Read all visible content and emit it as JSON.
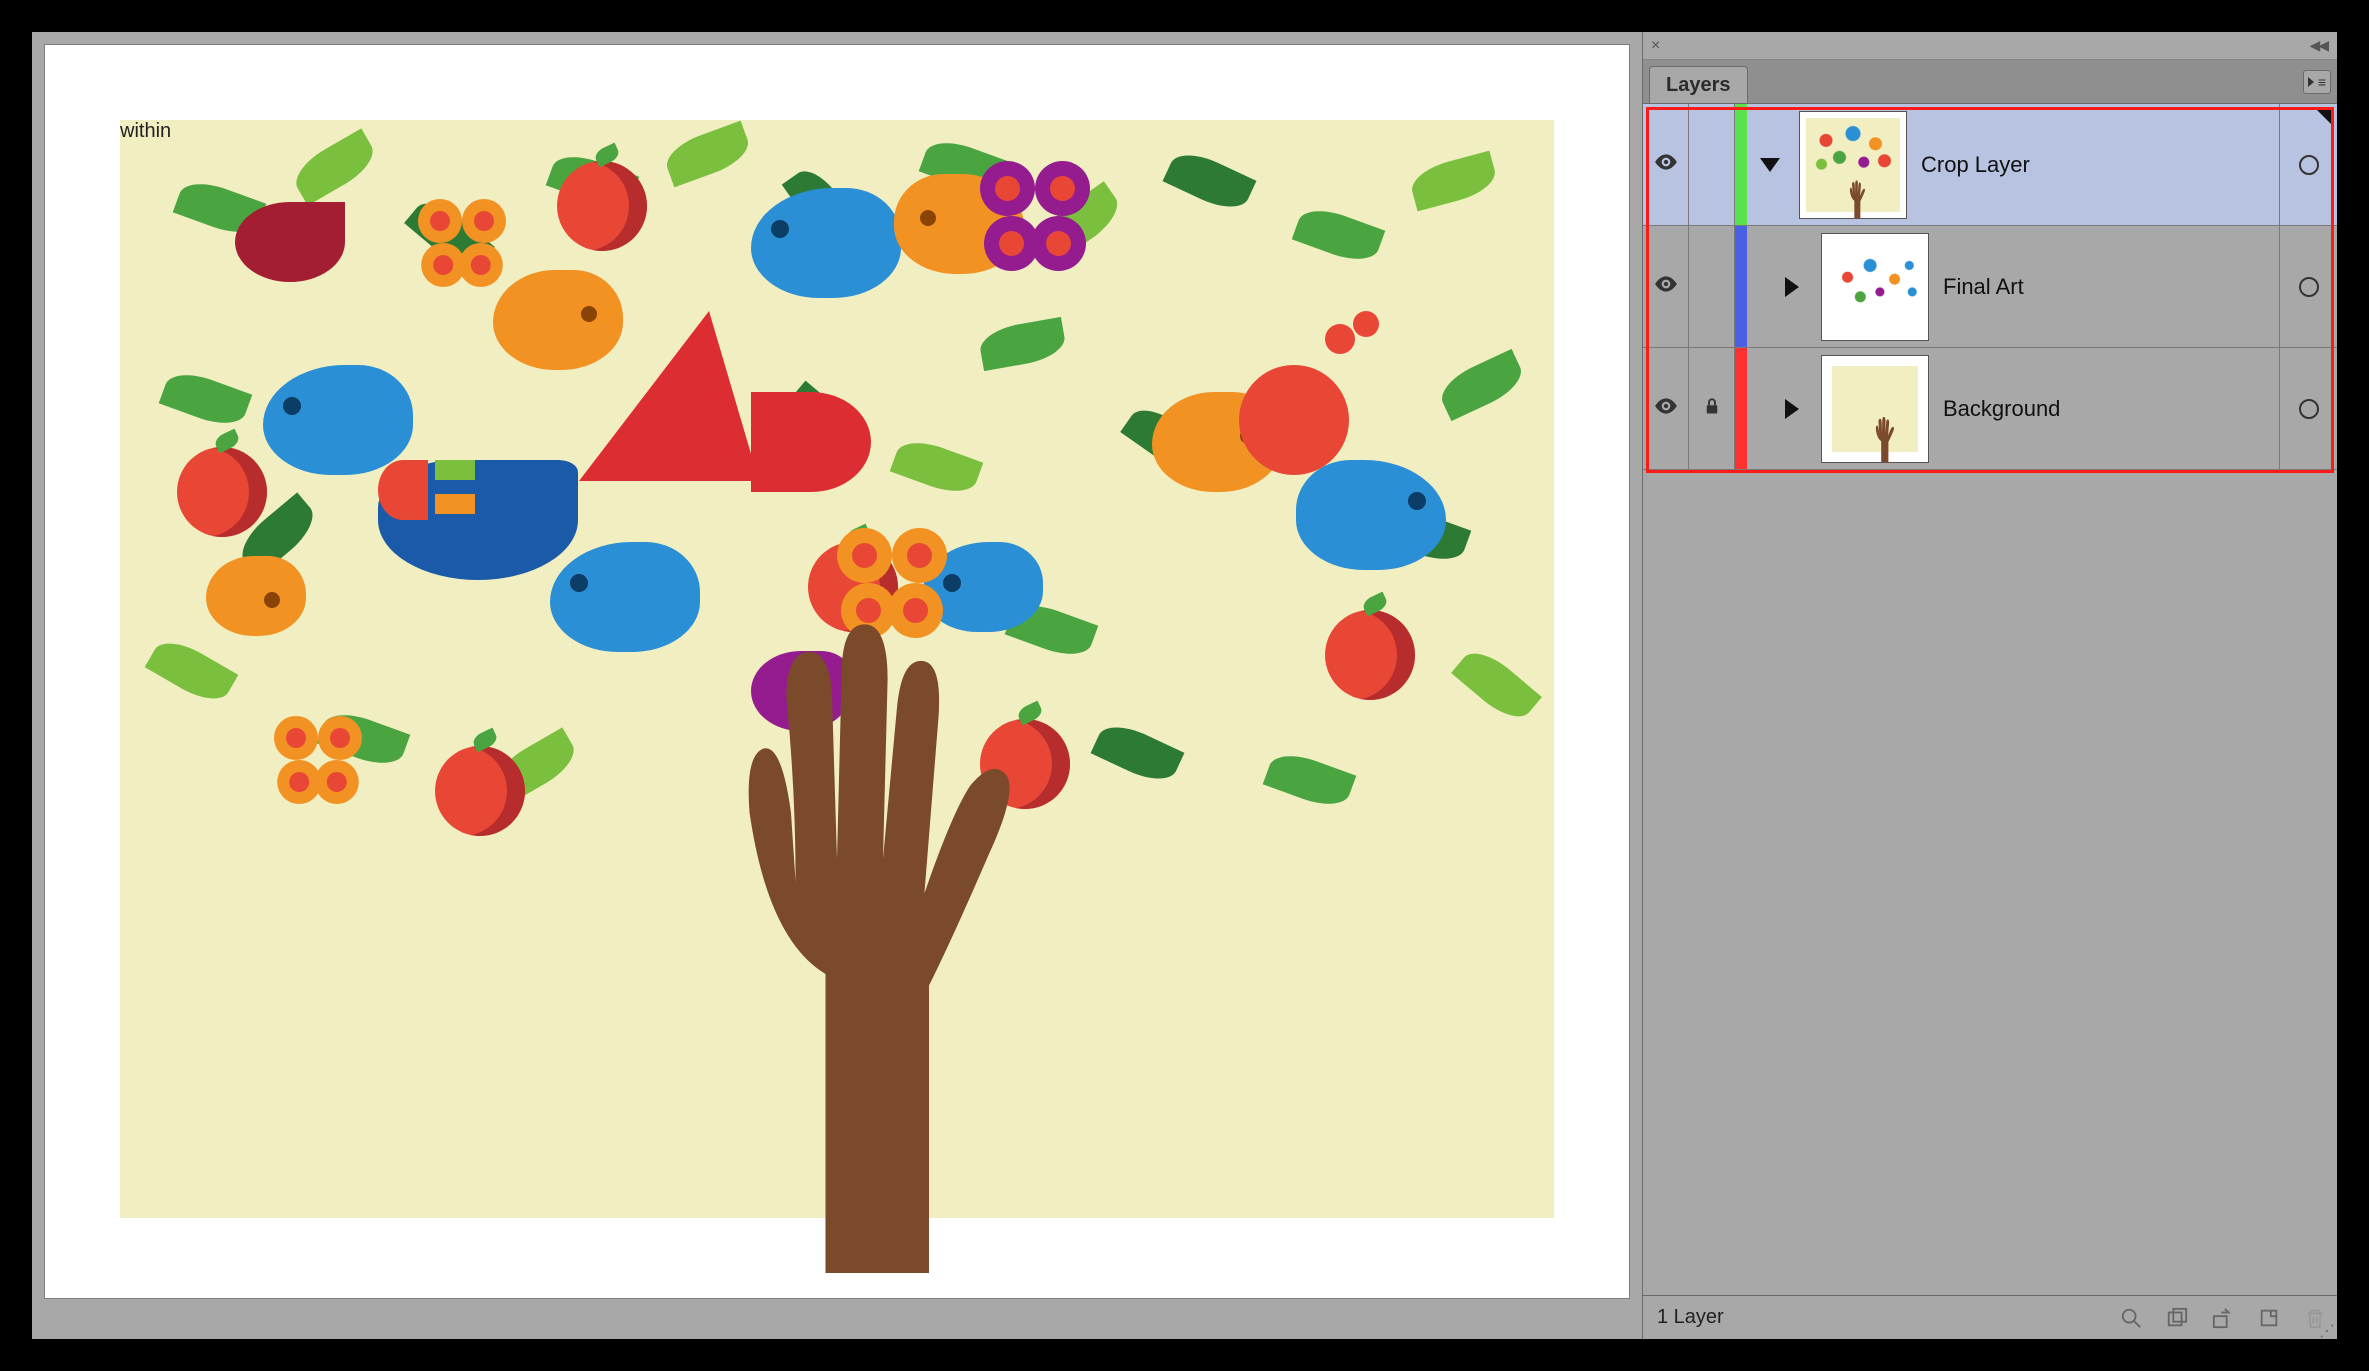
{
  "panel": {
    "tab_label": "Layers",
    "footer_status": "1 Layer"
  },
  "layers": [
    {
      "name": "Crop Layer",
      "visible": true,
      "locked": false,
      "expanded": true,
      "selected": true,
      "color": "#59e24b",
      "indent": 0,
      "thumb": "crop"
    },
    {
      "name": "Final Art",
      "visible": true,
      "locked": false,
      "expanded": false,
      "selected": false,
      "color": "#4a5fe2",
      "indent": 1,
      "thumb": "art"
    },
    {
      "name": "Background",
      "visible": true,
      "locked": true,
      "expanded": false,
      "selected": false,
      "color": "#ff3030",
      "indent": 1,
      "thumb": "bg"
    }
  ],
  "artwork": {
    "background_color": "#f1eec2",
    "trunk_color": "#7a4a2a",
    "palette": {
      "red": "#e94736",
      "dark_red": "#a41e33",
      "orange": "#f29223",
      "blue": "#2b8fd6",
      "green1": "#4aa541",
      "green2": "#7abf3e",
      "green3": "#2d7a35",
      "purple": "#951c8f"
    }
  }
}
